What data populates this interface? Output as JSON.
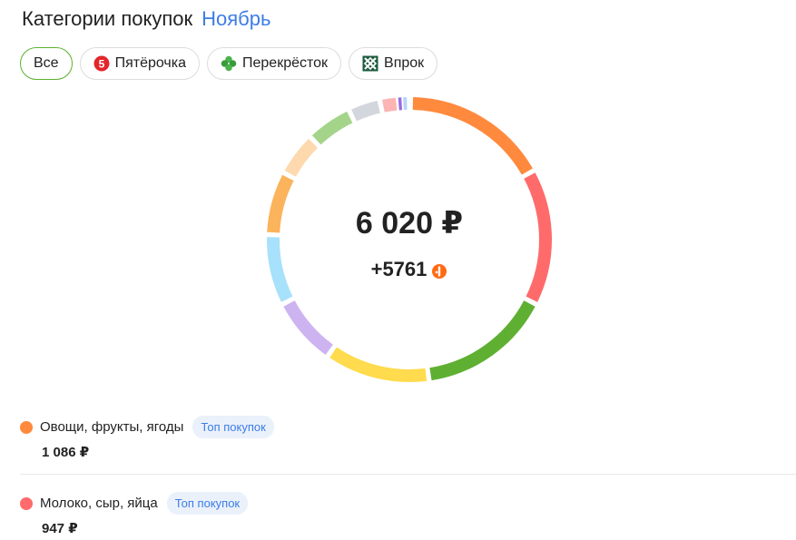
{
  "header": {
    "title": "Категории покупок",
    "month": "Ноябрь"
  },
  "filters": [
    {
      "label": "Все",
      "icon": "all",
      "active": true
    },
    {
      "label": "Пятёрочка",
      "icon": "pyaterochka-logo-icon"
    },
    {
      "label": "Перекрёсток",
      "icon": "perekrestok-logo-icon"
    },
    {
      "label": "Впрок",
      "icon": "vprok-logo-icon"
    }
  ],
  "summary": {
    "total": "6 020 ₽",
    "bonus": "+5761"
  },
  "donut_colors": [
    "#ff8a3d",
    "#ff6b6b",
    "#5fb032",
    "#ffdb4d",
    "#cdb4f0",
    "#a8e1fb",
    "#fbb35c",
    "#fdd9ad",
    "#a4d48a",
    "#d3d6dd",
    "#fcb4b4",
    "#9b6be0",
    "#b8d4fb"
  ],
  "categories": [
    {
      "name": "Овощи, фрукты, ягоды",
      "badge": "Топ покупок",
      "amount": "1 086 ₽",
      "color": "#ff8a3d"
    },
    {
      "name": "Молоко, сыр, яйца",
      "badge": "Топ покупок",
      "amount": "947 ₽",
      "color": "#ff6b6b"
    }
  ]
}
